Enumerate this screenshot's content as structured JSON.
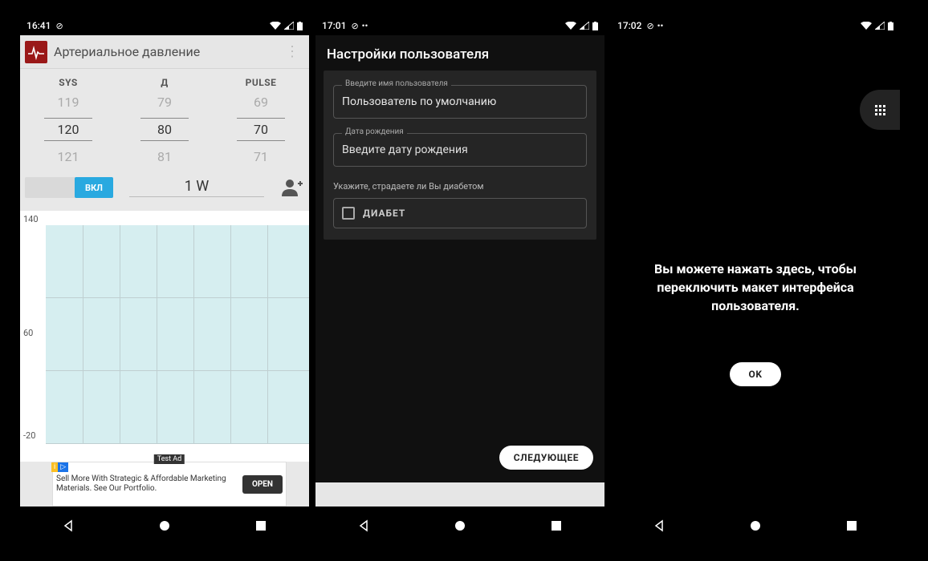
{
  "screen1": {
    "status": {
      "time": "16:41"
    },
    "appbar": {
      "title": "Артериальное давление"
    },
    "picker": {
      "headers": {
        "sys": "SYS",
        "dia": "Д",
        "pulse": "PULSE"
      },
      "sys": {
        "prev": "119",
        "sel": "120",
        "next": "121"
      },
      "dia": {
        "prev": "79",
        "sel": "80",
        "next": "81"
      },
      "pulse": {
        "prev": "69",
        "sel": "70",
        "next": "71"
      }
    },
    "toggle": {
      "label": "ВКЛ"
    },
    "range_label": "1 W",
    "chart_labels": {
      "y_top": "140",
      "y_mid": "60",
      "y_bot": "-20"
    },
    "ad": {
      "tag": "Test Ad",
      "text": "Sell More With Strategic & Affordable Marketing Materials. See Our Portfolio.",
      "cta": "OPEN"
    }
  },
  "screen2": {
    "status": {
      "time": "17:01"
    },
    "title": "Настройки пользователя",
    "fields": {
      "username": {
        "label": "Введите имя пользователя",
        "value": "Пользователь по умолчанию"
      },
      "dob": {
        "label": "Дата рождения",
        "placeholder": "Введите дату рождения"
      }
    },
    "diabetes": {
      "hint": "Укажите, страдаете ли Вы диабетом",
      "checkbox_label": "ДИАБЕТ"
    },
    "next": "СЛЕДУЮЩЕЕ"
  },
  "screen3": {
    "status": {
      "time": "17:02"
    },
    "message": "Вы можете нажать здесь, чтобы переключить макет интерфейса пользователя.",
    "ok": "OK"
  },
  "chart_data": {
    "type": "line",
    "title": "",
    "xlabel": "",
    "ylabel": "",
    "ylim": [
      -20,
      140
    ],
    "yticks": [
      -20,
      60,
      140
    ],
    "series": [
      {
        "name": "SYS",
        "values": []
      },
      {
        "name": "Д",
        "values": []
      },
      {
        "name": "PULSE",
        "values": []
      }
    ],
    "note": "empty chart — no plotted data points visible"
  }
}
